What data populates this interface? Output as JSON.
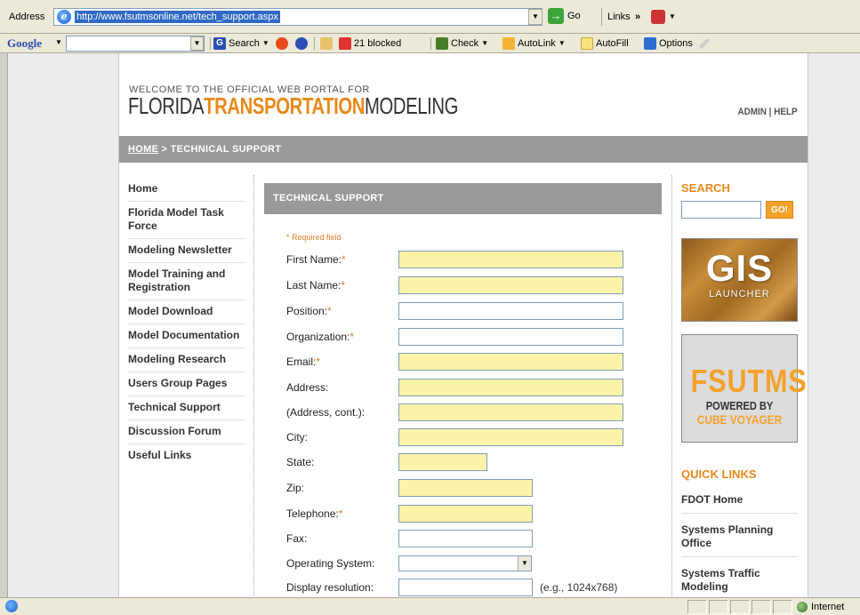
{
  "browser": {
    "address_label": "Address",
    "url": "http://www.fsutmsonline.net/tech_support.aspx",
    "go_label": "Go",
    "links_label": "Links",
    "links_chevron": "»"
  },
  "google_toolbar": {
    "logo": "Google",
    "search_label": "Search",
    "blocked_label": "21 blocked",
    "check_label": "Check",
    "autolink_label": "AutoLink",
    "autofill_label": "AutoFill",
    "options_label": "Options"
  },
  "header": {
    "welcome": "WELCOME TO THE OFFICIAL WEB PORTAL FOR",
    "logo_part1": "FLORIDA",
    "logo_part2": "TRANSPORTATION",
    "logo_part3": "MODELING",
    "admin_label": "ADMIN",
    "separator": " | ",
    "help_label": "HELP"
  },
  "breadcrumb": {
    "home": "HOME",
    "sep": " > ",
    "current": "TECHNICAL SUPPORT"
  },
  "leftnav": {
    "items": [
      "Home",
      "Florida Model Task Force",
      "Modeling Newsletter",
      "Model Training and Registration",
      "Model Download",
      "Model Documentation",
      "Modeling Research",
      "Users Group Pages",
      "Technical Support",
      "Discussion Forum",
      "Useful Links"
    ]
  },
  "form": {
    "title": "TECHNICAL SUPPORT",
    "required_note": "* Required field",
    "fields": {
      "first_name": "First Name:",
      "last_name": "Last Name:",
      "position": "Position:",
      "organization": "Organization:",
      "email": "Email:",
      "address": "Address:",
      "address2": "(Address, cont.):",
      "city": "City:",
      "state": "State:",
      "zip": "Zip:",
      "telephone": "Telephone:",
      "fax": "Fax:",
      "os": "Operating System:",
      "resolution": "Display resolution:"
    },
    "required_star": "*",
    "resolution_hint": "(e.g., 1024x768)"
  },
  "sidebar": {
    "search_heading": "SEARCH",
    "go_label": "GO!",
    "gis_big": "GIS",
    "gis_small": "LAUNCHER",
    "fsutms_big": "FSUTMS",
    "fsutms_powered": "POWERED BY",
    "fsutms_cube": "CUBE VOYAGER",
    "quicklinks_heading": "QUICK LINKS",
    "quicklinks": [
      "FDOT Home",
      "Systems Planning Office",
      "Systems Traffic Modeling"
    ]
  },
  "status": {
    "zone": "Internet"
  }
}
